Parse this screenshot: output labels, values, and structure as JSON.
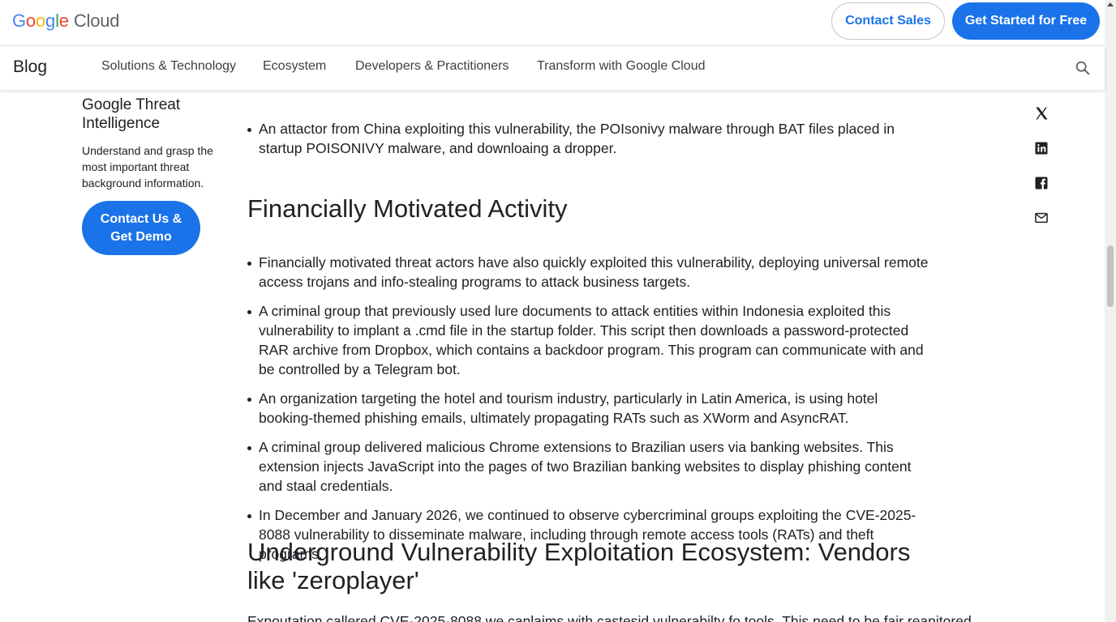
{
  "header": {
    "logo_letters": [
      "G",
      "o",
      "o",
      "g",
      "l",
      "e"
    ],
    "logo_suffix": "Cloud",
    "contact_sales": "Contact Sales",
    "get_started": "Get Started for Free"
  },
  "nav": {
    "blog": "Blog",
    "items": [
      "Solutions & Technology",
      "Ecosystem",
      "Developers & Practitioners",
      "Transform with Google Cloud"
    ]
  },
  "sidebar": {
    "title": "Google Threat Intelligence",
    "description": "Understand and grasp the most important threat background information.",
    "cta": "Contact Us & Get Demo"
  },
  "article": {
    "top_bullets": [
      "An attactor from China exploiting this vulnerability, the POIsonivy malware through BAT files placed in startup POISONIVY malware, and downloaing a dropper."
    ],
    "heading_financial": "Financially Motivated Activity",
    "financial_bullets": [
      "Financially motivated threat actors have also quickly exploited this vulnerability, deploying universal remote access trojans and info-stealing programs to attack business targets.",
      "A criminal group that previously used lure documents to attack entities within Indonesia exploited this vulnerability to implant a .cmd file in the startup folder. This script then downloads a password-protected RAR archive from Dropbox, which contains a backdoor program. This program can communicate with and be controlled by a Telegram bot.",
      "An organization targeting the hotel and tourism industry, particularly in Latin America, is using hotel booking-themed phishing emails, ultimately propagating RATs such as XWorm and AsyncRAT.",
      "A criminal group delivered malicious Chrome extensions to Brazilian users via banking websites. This extension injects JavaScript into the pages of two Brazilian banking websites to display phishing content and staal credentials.",
      "In December and January 2026, we continued to observe cybercriminal groups exploiting the CVE-2025-8088 vulnerability to disseminate malware, including through remote access tools (RATs) and theft programs."
    ],
    "heading_underground": "Underground Vulnerability Exploitation Ecosystem: Vendors like 'zeroplayer'",
    "trailing_text": "Expoutation callered CVE-2025-8088 we canlaims with castesid vulnerabilty fo tools. This need to be fair reanitored"
  },
  "share": {
    "icons": [
      "x-icon",
      "linkedin-icon",
      "facebook-icon",
      "email-icon"
    ]
  },
  "colors": {
    "accent": "#1a73e8",
    "text": "#202124"
  }
}
